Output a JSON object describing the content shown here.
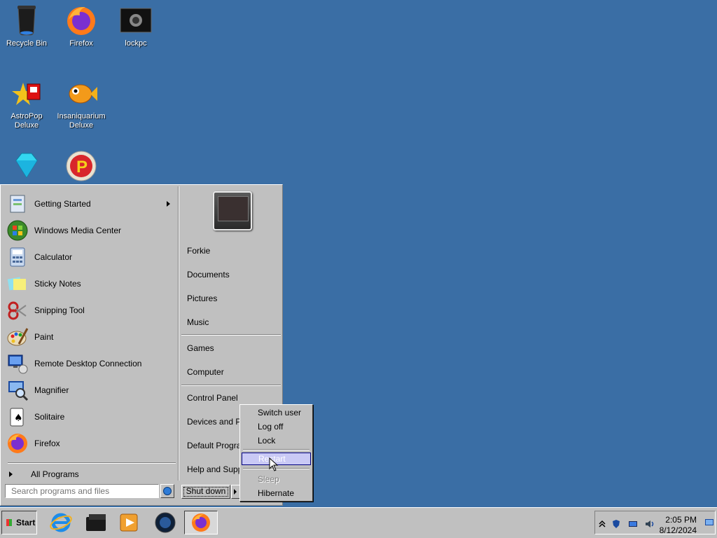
{
  "desktop": {
    "icons": [
      {
        "label": "Recycle Bin"
      },
      {
        "label": "Firefox"
      },
      {
        "label": "lockpc"
      },
      {
        "label": "AstroPop Deluxe"
      },
      {
        "label": "Insaniquarium Deluxe"
      },
      {
        "label": ""
      },
      {
        "label": ""
      }
    ],
    "background": "#3a6ea5"
  },
  "start_menu": {
    "programs": [
      {
        "label": "Getting Started",
        "icon": "getting-started-icon",
        "has_submenu": true
      },
      {
        "label": "Windows Media Center",
        "icon": "media-center-icon"
      },
      {
        "label": "Calculator",
        "icon": "calculator-icon"
      },
      {
        "label": "Sticky Notes",
        "icon": "sticky-notes-icon"
      },
      {
        "label": "Snipping Tool",
        "icon": "scissors-icon"
      },
      {
        "label": "Paint",
        "icon": "paint-palette-icon"
      },
      {
        "label": "Remote Desktop Connection",
        "icon": "remote-desktop-icon"
      },
      {
        "label": "Magnifier",
        "icon": "magnifier-icon"
      },
      {
        "label": "Solitaire",
        "icon": "cards-icon"
      },
      {
        "label": "Firefox",
        "icon": "firefox-icon"
      }
    ],
    "all_programs_label": "All Programs",
    "right_links": {
      "user": "Forkie",
      "documents": "Documents",
      "pictures": "Pictures",
      "music": "Music",
      "games": "Games",
      "computer": "Computer",
      "control_panel": "Control Panel",
      "devices": "Devices and Printers",
      "default_programs": "Default Programs",
      "help": "Help and Support"
    },
    "search_placeholder": "Search programs and files",
    "shutdown_label": "Shut down"
  },
  "shutdown_menu": {
    "switch_user": "Switch user",
    "log_off": "Log off",
    "lock": "Lock",
    "restart": "Restart",
    "sleep": "Sleep",
    "hibernate": "Hibernate",
    "highlighted": "Restart",
    "disabled": [
      "Sleep"
    ]
  },
  "taskbar": {
    "start_label": "Start",
    "pinned": [
      "internet-explorer-icon",
      "folder-icon",
      "media-player-icon",
      "orb-icon",
      "firefox-icon"
    ],
    "clock_time": "2:05 PM",
    "clock_date": "8/12/2024"
  }
}
